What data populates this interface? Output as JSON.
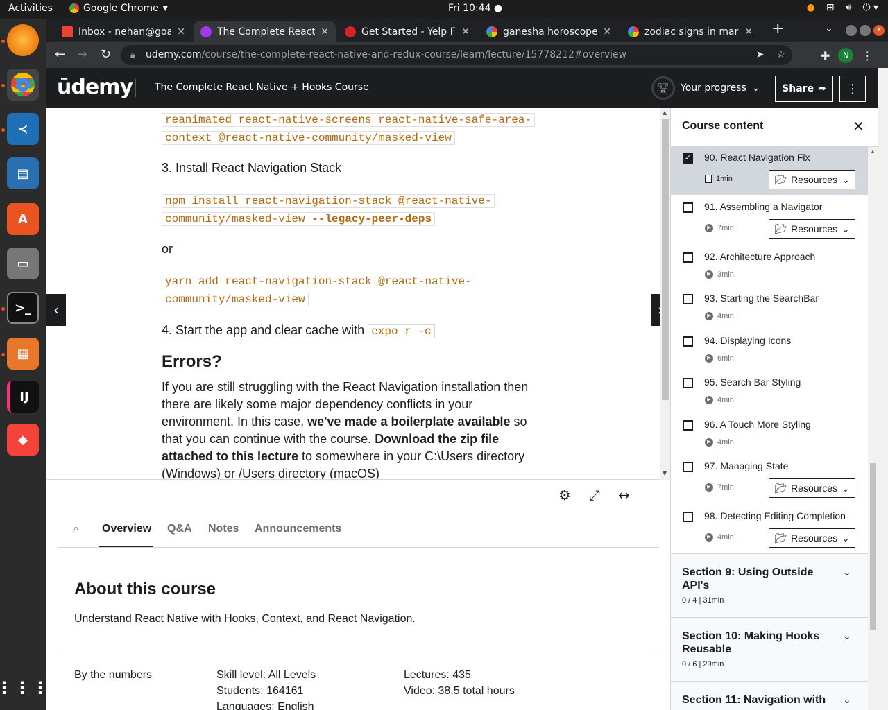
{
  "os": {
    "activities": "Activities",
    "app_name": "Google Chrome",
    "clock": "Fri 10:44"
  },
  "browser": {
    "tabs": [
      {
        "title": "Inbox - nehan@goa.l",
        "favicon_color": "#ea4335",
        "favicon": "gmail-icon"
      },
      {
        "title": "The Complete React",
        "favicon_color": "#a435f0",
        "favicon": "udemy-icon"
      },
      {
        "title": "Get Started - Yelp Fu",
        "favicon_color": "#d32323",
        "favicon": "yelp-icon"
      },
      {
        "title": "ganesha horoscope",
        "favicon_color": "#4285f4",
        "favicon": "google-icon"
      },
      {
        "title": "zodiac signs in mara",
        "favicon_color": "#4285f4",
        "favicon": "google-icon"
      }
    ],
    "url_host": "udemy.com",
    "url_path": "/course/the-complete-react-native-and-redux-course/learn/lecture/15778212#overview",
    "profile_initial": "N"
  },
  "header": {
    "logo": "ūdemy",
    "course_title": "The Complete React Native + Hooks Course",
    "progress_label": "Your progress",
    "share_label": "Share"
  },
  "article": {
    "code1_line1": "reanimated react-native-screens react-native-safe-area-",
    "code1_line2": "context @react-native-community/masked-view",
    "step3": "3. Install React Navigation Stack",
    "code2_line1": "npm install react-navigation-stack @react-native-",
    "code2_line2a": "community/masked-view ",
    "code2_line2b": "--legacy-peer-deps",
    "or": "or",
    "code3_line1": "yarn add react-navigation-stack @react-native-",
    "code3_line2": "community/masked-view",
    "step4": "4. Start the app and clear cache with ",
    "step4_code": "expo r -c",
    "errors_heading": "Errors?",
    "p1": "If you are still struggling with the React Navigation installation then there are likely some major dependency conflicts in your environment. In this case, ",
    "p1_bold": "we've made a boilerplate available",
    "p2": " so that you can continue with the course. ",
    "p2_bold": "Download the zip file attached to this lecture",
    "p3": " to somewhere in your C:\\Users directory (Windows) or /Users directory (macOS)"
  },
  "course_tabs": {
    "overview": "Overview",
    "qa": "Q&A",
    "notes": "Notes",
    "announcements": "Announcements"
  },
  "about": {
    "title": "About this course",
    "description": "Understand React Native with Hooks, Context, and React Navigation.",
    "by_numbers": "By the numbers",
    "skill": "Skill level: All Levels",
    "students": "Students: 164161",
    "languages": "Languages: English",
    "lectures": "Lectures: 435",
    "video": "Video: 38.5 total hours"
  },
  "sidebar": {
    "title": "Course content",
    "resources_label": "Resources",
    "lectures": [
      {
        "title": "90. React Navigation Fix",
        "duration": "1min",
        "checked": true,
        "resources": true,
        "kind": "doc"
      },
      {
        "title": "91. Assembling a Navigator",
        "duration": "7min",
        "checked": false,
        "resources": true,
        "kind": "video"
      },
      {
        "title": "92. Architecture Approach",
        "duration": "3min",
        "checked": false,
        "resources": false,
        "kind": "video"
      },
      {
        "title": "93. Starting the SearchBar",
        "duration": "4min",
        "checked": false,
        "resources": false,
        "kind": "video"
      },
      {
        "title": "94. Displaying Icons",
        "duration": "6min",
        "checked": false,
        "resources": false,
        "kind": "video"
      },
      {
        "title": "95. Search Bar Styling",
        "duration": "4min",
        "checked": false,
        "resources": false,
        "kind": "video"
      },
      {
        "title": "96. A Touch More Styling",
        "duration": "4min",
        "checked": false,
        "resources": false,
        "kind": "video"
      },
      {
        "title": "97. Managing State",
        "duration": "7min",
        "checked": false,
        "resources": true,
        "kind": "video"
      },
      {
        "title": "98. Detecting Editing Completion",
        "duration": "4min",
        "checked": false,
        "resources": true,
        "kind": "video"
      }
    ],
    "sections": [
      {
        "title": "Section 9: Using Outside API's",
        "meta": "0 / 4 | 31min"
      },
      {
        "title": "Section 10: Making Hooks Reusable",
        "meta": "0 / 6 | 29min"
      },
      {
        "title": "Section 11: Navigation with",
        "meta": ""
      }
    ]
  }
}
